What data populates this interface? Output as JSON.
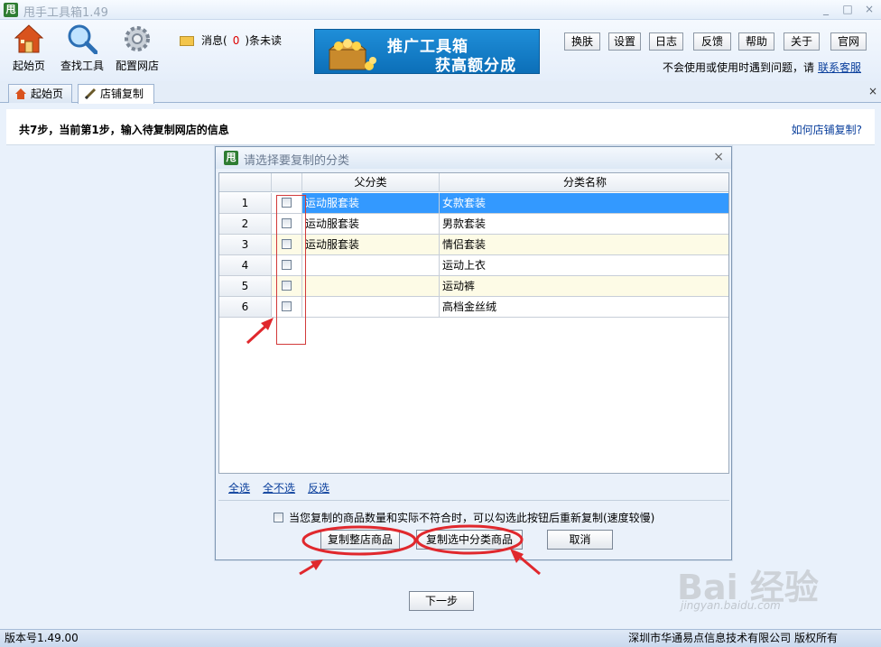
{
  "window": {
    "app_icon": "甩",
    "title": "甩手工具箱1.49",
    "min": "_",
    "max": "□",
    "close": "×"
  },
  "toolbar": {
    "tools": [
      {
        "label": "起始页",
        "icon": "home-icon"
      },
      {
        "label": "查找工具",
        "icon": "magnifier-icon"
      },
      {
        "label": "配置网店",
        "icon": "gear-icon"
      }
    ],
    "message": {
      "prefix": "消息(",
      "count": "0",
      "suffix": ")条未读"
    },
    "banner": {
      "line1": "推广工具箱",
      "line2": "获高额分成"
    },
    "buttons": [
      "换肤",
      "设置",
      "日志",
      "反馈",
      "帮助",
      "关于",
      "官网"
    ],
    "help_note": "不会使用或使用时遇到问题，请",
    "help_link": "联系客服"
  },
  "tabs": [
    {
      "label": "起始页",
      "icon": "home-icon",
      "active": false
    },
    {
      "label": "店铺复制",
      "icon": "pencil-icon",
      "active": true
    }
  ],
  "tab_close": "×",
  "step": {
    "text": "共7步，当前第1步，输入待复制网店的信息",
    "howto": "如何店铺复制?"
  },
  "dialog": {
    "icon": "甩",
    "title": "请选择要复制的分类",
    "close": "×",
    "columns": {
      "parent": "父分类",
      "name": "分类名称"
    },
    "rows": [
      {
        "num": "1",
        "parent": "运动服套装",
        "name": "女款套装",
        "selected": true
      },
      {
        "num": "2",
        "parent": "运动服套装",
        "name": "男款套装",
        "selected": false
      },
      {
        "num": "3",
        "parent": "运动服套装",
        "name": "情侣套装",
        "selected": false
      },
      {
        "num": "4",
        "parent": "",
        "name": "运动上衣",
        "selected": false
      },
      {
        "num": "5",
        "parent": "",
        "name": "运动裤",
        "selected": false
      },
      {
        "num": "6",
        "parent": "",
        "name": "高档金丝绒",
        "selected": false
      }
    ],
    "links": {
      "select_all": "全选",
      "select_none": "全不选",
      "invert": "反选"
    },
    "option": "当您复制的商品数量和实际不符合时，可以勾选此按钮后重新复制(速度较慢)",
    "buttons": {
      "copy_all": "复制整店商品",
      "copy_selected": "复制选中分类商品",
      "cancel": "取消"
    }
  },
  "next": "下一步",
  "status": {
    "version": "版本号1.49.00",
    "copyright": "深圳市华通易点信息技术有限公司 版权所有"
  },
  "watermark": {
    "brand": "Bai 经验",
    "url": "jingyan.baidu.com"
  },
  "colors": {
    "selected_row": "#3399ff",
    "alt_row": "#fdfbe6",
    "annotation_red": "#e0282d",
    "link": "#0a3f9c"
  }
}
